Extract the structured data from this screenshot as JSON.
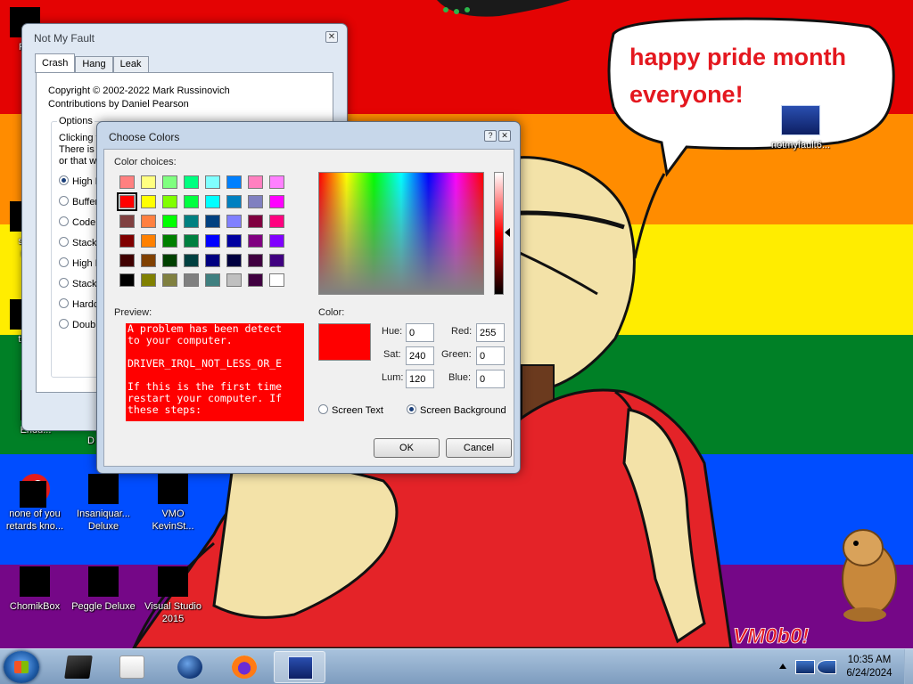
{
  "desktop": {
    "bubble_text": [
      "happy pride month",
      "everyone!"
    ],
    "watermark": "VM0b0!",
    "stripe_colors": [
      "#e40303",
      "#ff8c00",
      "#ffed00",
      "#008026",
      "#004dff",
      "#750787"
    ],
    "icons": [
      {
        "l1": "Re",
        "l2": ""
      },
      {
        "l1": "sor",
        "l2": "ra"
      },
      {
        "l1": "tha",
        "l2": ""
      },
      {
        "l1": "Endu...",
        "l2": ""
      },
      {
        "l1": "",
        "l2": "D"
      },
      {
        "l1": "none of you",
        "l2": "retards kno..."
      },
      {
        "l1": "Insaniquar...",
        "l2": "Deluxe"
      },
      {
        "l1": "VMO",
        "l2": "KevinSt..."
      },
      {
        "l1": "ChomikBox",
        "l2": ""
      },
      {
        "l1": "Peggle Deluxe",
        "l2": ""
      },
      {
        "l1": "Visual Studio",
        "l2": "2015"
      },
      {
        "l1": "notmyfault6...",
        "l2": ""
      }
    ]
  },
  "nmf": {
    "title": "Not My Fault",
    "close": "✕",
    "tabs": [
      "Crash",
      "Hang",
      "Leak"
    ],
    "copyright": "Copyright © 2002-2022 Mark Russinovich",
    "contrib": "Contributions by Daniel Pearson",
    "options_legend": "Options",
    "desc": [
      "Clicking th",
      "There is a",
      "or that w"
    ],
    "radios": [
      "High IR",
      "Buffer",
      "Code o",
      "Stack",
      "High IR",
      "Stack",
      "Hardco",
      "Double"
    ]
  },
  "dialog": {
    "title": "Choose Colors",
    "help": "?",
    "close": "✕",
    "color_choices_label": "Color choices:",
    "preview_label": "Preview:",
    "color_label": "Color:",
    "preview_text": "A problem has been detect\nto your computer.\n\nDRIVER_IRQL_NOT_LESS_OR_E\n\nIf this is the first time\nrestart your computer. If\nthese steps:",
    "fields": {
      "hue_label": "Hue:",
      "hue": "0",
      "sat_label": "Sat:",
      "sat": "240",
      "lum_label": "Lum:",
      "lum": "120",
      "red_label": "Red:",
      "red": "255",
      "green_label": "Green:",
      "green": "0",
      "blue_label": "Blue:",
      "blue": "0"
    },
    "screen_text": "Screen Text",
    "screen_bg": "Screen Background",
    "selected_mode": "Screen Background",
    "ok": "OK",
    "cancel": "Cancel",
    "current_color": "#ff0000",
    "swatches": [
      [
        "#ff8080",
        "#ffff80",
        "#80ff80",
        "#00ff80",
        "#80ffff",
        "#0080ff",
        "#ff80c0",
        "#ff80ff"
      ],
      [
        "#ff0000",
        "#ffff00",
        "#80ff00",
        "#00ff40",
        "#00ffff",
        "#0080c0",
        "#8080c0",
        "#ff00ff"
      ],
      [
        "#804040",
        "#ff8040",
        "#00ff00",
        "#008080",
        "#004080",
        "#8080ff",
        "#800040",
        "#ff0080"
      ],
      [
        "#800000",
        "#ff8000",
        "#008000",
        "#008040",
        "#0000ff",
        "#0000a0",
        "#800080",
        "#8000ff"
      ],
      [
        "#400000",
        "#804000",
        "#004000",
        "#004040",
        "#000080",
        "#000040",
        "#400040",
        "#400080"
      ],
      [
        "#000000",
        "#808000",
        "#808040",
        "#808080",
        "#408080",
        "#c0c0c0",
        "#400040",
        "#ffffff"
      ]
    ],
    "selected_swatch": [
      1,
      0
    ]
  },
  "taskbar": {
    "time": "10:35 AM",
    "date": "6/24/2024"
  }
}
